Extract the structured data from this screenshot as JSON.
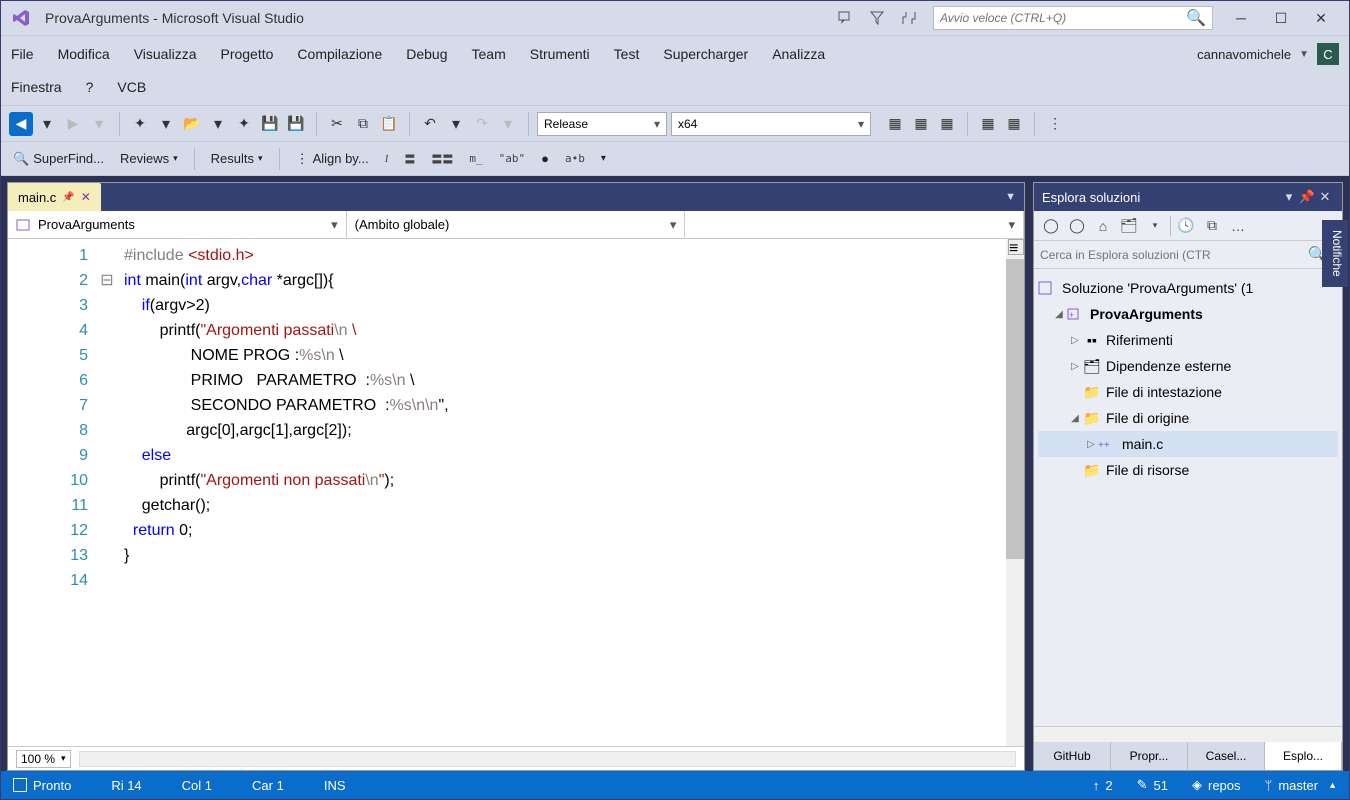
{
  "titlebar": {
    "title": "ProvaArguments - Microsoft Visual Studio",
    "quick_launch_placeholder": "Avvio veloce (CTRL+Q)"
  },
  "menu": [
    "File",
    "Modifica",
    "Visualizza",
    "Progetto",
    "Compilazione",
    "Debug",
    "Team",
    "Strumenti",
    "Test",
    "Supercharger",
    "Analizza"
  ],
  "menu_row2": [
    "Finestra",
    "?",
    "VCB"
  ],
  "user": {
    "name": "cannavomichele",
    "initial": "C"
  },
  "toolbar": {
    "config": "Release",
    "platform": "x64"
  },
  "toolbar2": {
    "superfind": "SuperFind...",
    "reviews": "Reviews",
    "results": "Results",
    "alignby": "Align by..."
  },
  "editor": {
    "tab_name": "main.c",
    "nav_project": "ProvaArguments",
    "nav_scope": "(Ambito globale)",
    "nav_member": "",
    "zoom": "100 %",
    "line_count": 14,
    "code_lines": [
      {
        "n": 1,
        "html": "<span class='pp'>#include</span> <span class='inc'>&lt;stdio.h&gt;</span>"
      },
      {
        "n": 2,
        "html": "<span class='kw'>int</span> main(<span class='kw'>int</span> argv,<span class='kw'>char</span> *argc[]){"
      },
      {
        "n": 3,
        "html": "    <span class='kw'>if</span>(argv&gt;2)"
      },
      {
        "n": 4,
        "html": "        printf(<span class='str'>\"Argomenti passati<span class='esc'>\\n</span> \\"
      },
      {
        "n": 5,
        "html": "               NOME PROG :<span class='esc'>%s\\n</span> \\"
      },
      {
        "n": 6,
        "html": "               PRIMO   PARAMETRO  :<span class='esc'>%s\\n</span> \\"
      },
      {
        "n": 7,
        "html": "               SECONDO PARAMETRO  :<span class='esc'>%s\\n\\n</span>\"</span>,"
      },
      {
        "n": 8,
        "html": "              argc[0],argc[1],argc[2]);"
      },
      {
        "n": 9,
        "html": "    <span class='kw'>else</span>"
      },
      {
        "n": 10,
        "html": "        printf(<span class='str'>\"Argomenti non passati<span class='esc'>\\n</span>\"</span>);"
      },
      {
        "n": 11,
        "html": "    getchar();"
      },
      {
        "n": 12,
        "html": "  <span class='kw'>return</span> 0;"
      },
      {
        "n": 13,
        "html": "}"
      },
      {
        "n": 14,
        "html": ""
      }
    ]
  },
  "solution_explorer": {
    "title": "Esplora soluzioni",
    "search_placeholder": "Cerca in Esplora soluzioni (CTR",
    "nodes": {
      "solution": "Soluzione 'ProvaArguments'  (1",
      "project": "ProvaArguments",
      "refs": "Riferimenti",
      "extdeps": "Dipendenze esterne",
      "headers": "File di intestazione",
      "sources": "File di origine",
      "mainc": "main.c",
      "resfiles": "File di risorse"
    },
    "bottom_tabs": [
      "GitHub",
      "Propr...",
      "Casel...",
      "Esplo..."
    ]
  },
  "side_pane_tab": "Notifiche",
  "statusbar": {
    "ready": "Pronto",
    "line": "Ri 14",
    "col": "Col 1",
    "char": "Car 1",
    "ins": "INS",
    "changes_up": "2",
    "pending": "51",
    "repo": "repos",
    "branch": "master"
  }
}
